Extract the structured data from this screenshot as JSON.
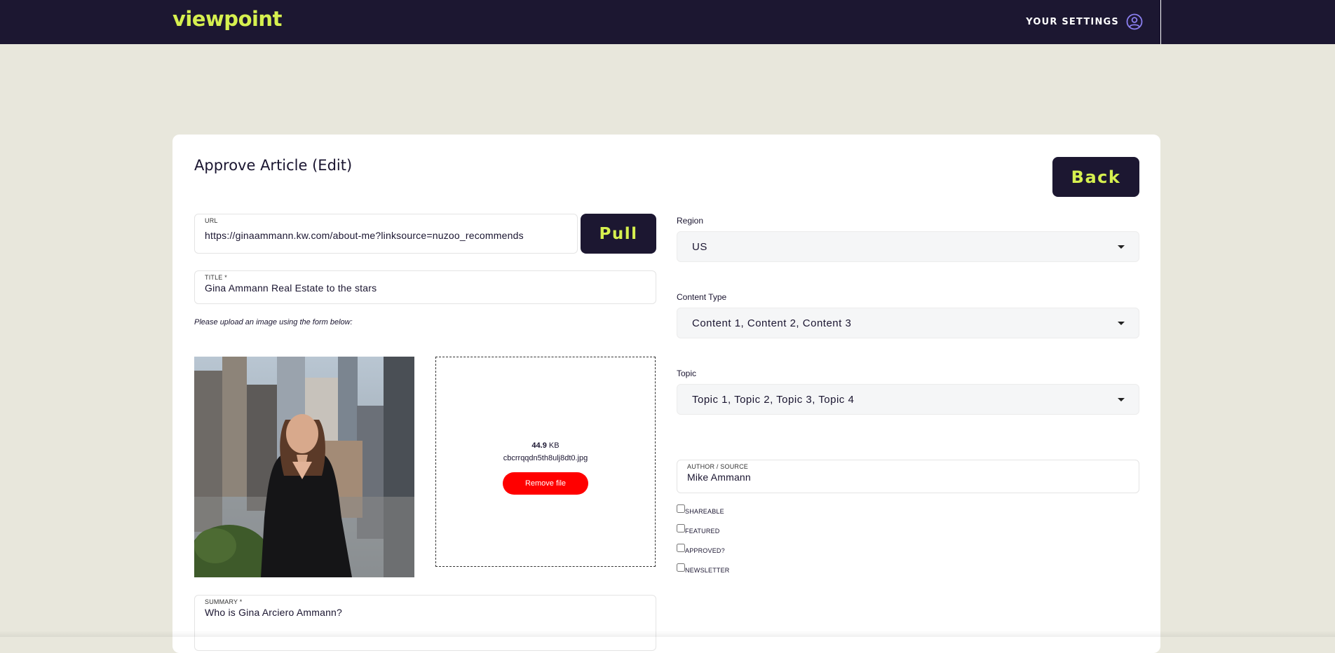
{
  "brand": {
    "logo_text": "viewpoint",
    "accent": "#d6f04f",
    "dark": "#1c1731"
  },
  "nav": {
    "settings_label": "YOUR SETTINGS",
    "settings_icon": "user-circle-icon"
  },
  "page": {
    "title": "Approve Article (Edit)",
    "back_label": "Back"
  },
  "form": {
    "url": {
      "label": "URL",
      "value": "https://ginaammann.kw.com/about-me?linksource=nuzoo_recommends"
    },
    "pull_label": "Pull",
    "title": {
      "label": "TITLE *",
      "value": "Gina Ammann Real Estate to the stars"
    },
    "upload_hint": "Please upload an image using the form below:",
    "file": {
      "size_num": "44.9",
      "size_unit": " KB",
      "name": "cbcrrqqdn5th8ulj8dt0.jpg",
      "remove_label": "Remove file"
    },
    "summary": {
      "label": "SUMMARY *",
      "value": "Who is Gina Arciero Ammann?"
    },
    "region": {
      "label": "Region",
      "value": "US"
    },
    "content_type": {
      "label": "Content Type",
      "value": "Content 1, Content 2, Content 3"
    },
    "topic": {
      "label": "Topic",
      "value": "Topic 1, Topic 2, Topic 3, Topic 4"
    },
    "author": {
      "label": "AUTHOR / SOURCE",
      "value": "Mike Ammann"
    },
    "checkboxes": [
      {
        "label": "SHAREABLE",
        "checked": false
      },
      {
        "label": "FEATURED",
        "checked": false
      },
      {
        "label": "APPROVED?",
        "checked": false
      },
      {
        "label": "NEWSLETTER",
        "checked": false
      }
    ],
    "remove_color": "#ff0000"
  }
}
